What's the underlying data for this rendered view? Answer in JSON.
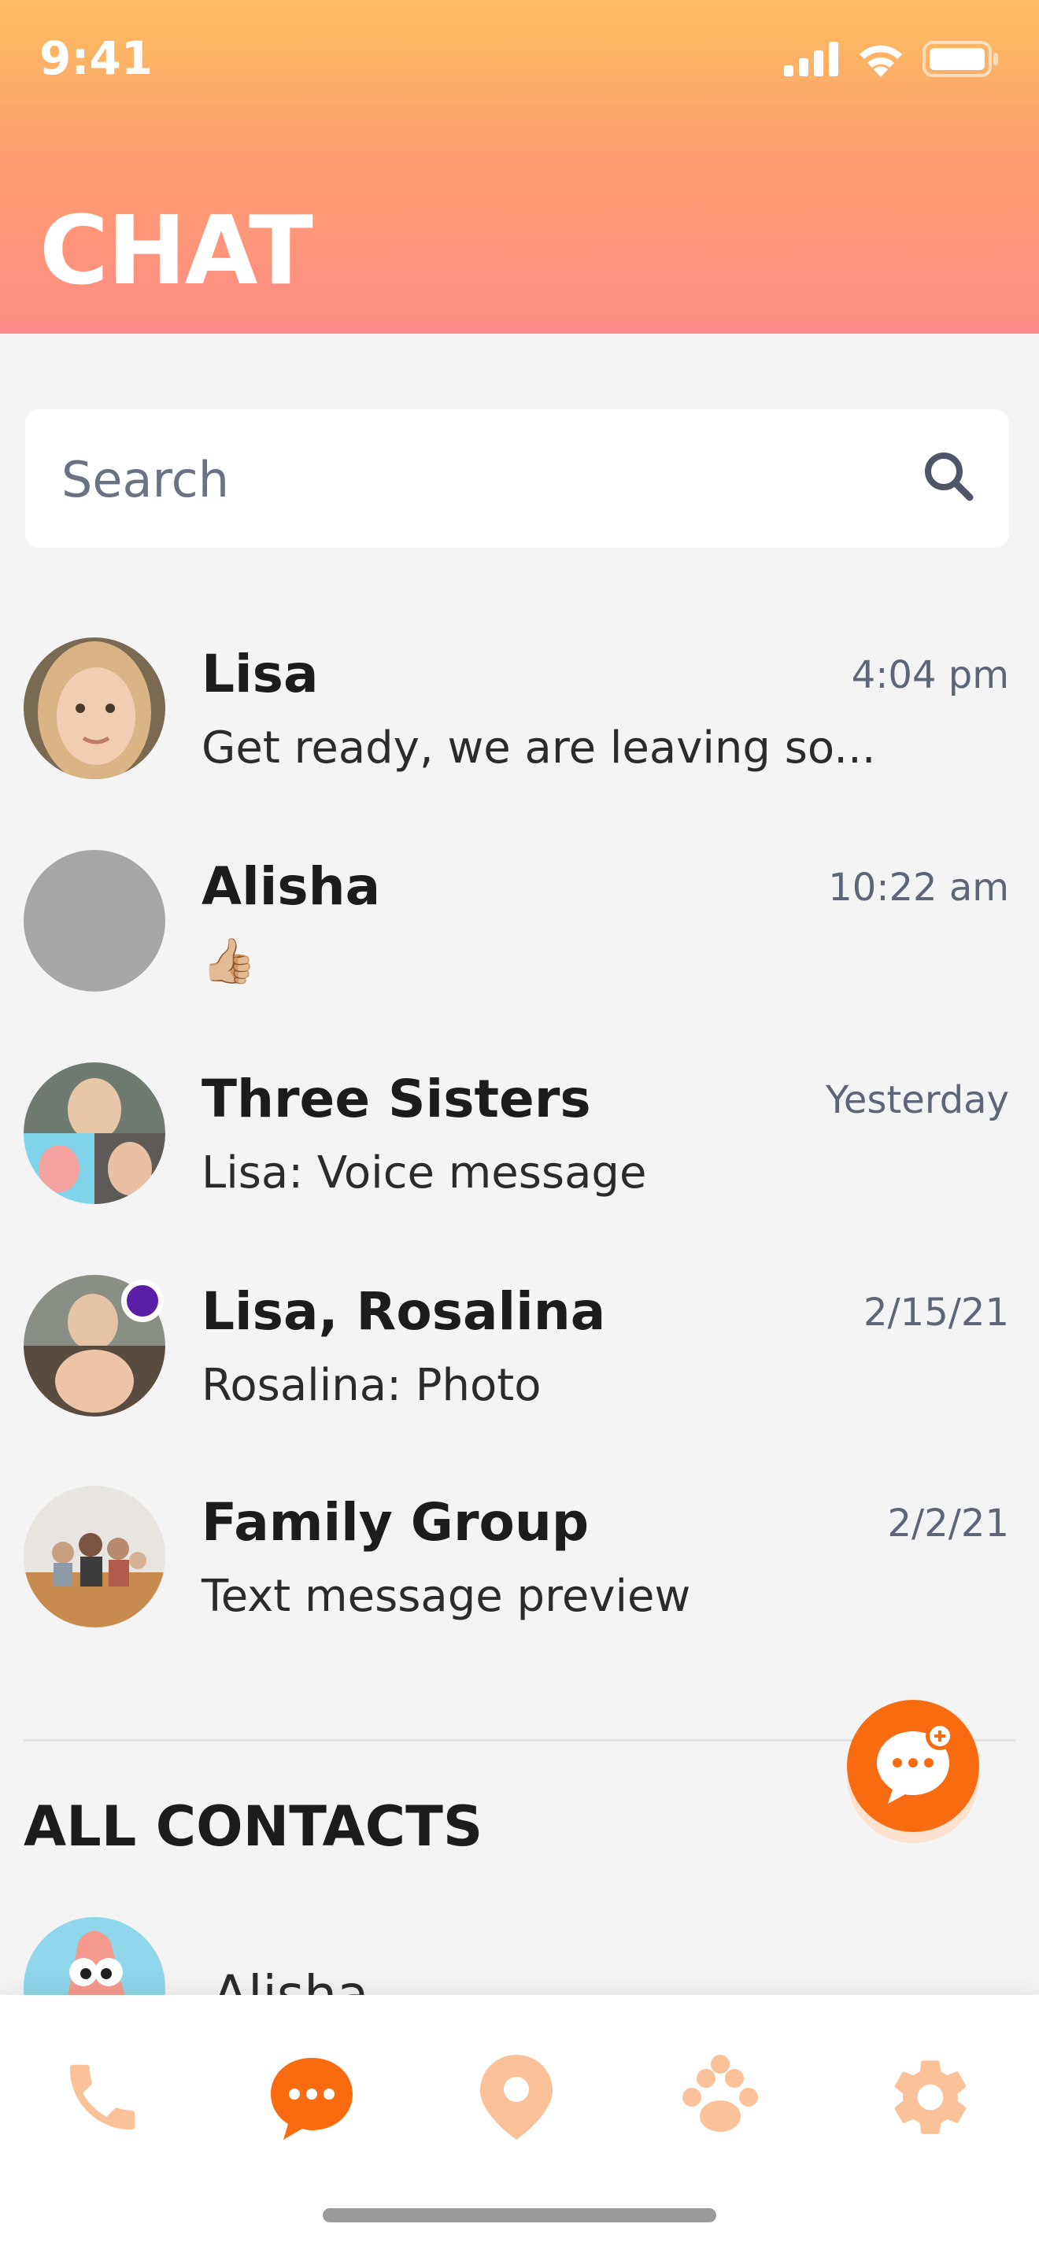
{
  "status_bar": {
    "time": "9:41"
  },
  "header": {
    "title": "CHAT"
  },
  "search": {
    "placeholder": "Search"
  },
  "chats": [
    {
      "name": "Lisa",
      "time": "4:04 pm",
      "preview": "Get ready, we are leaving so..."
    },
    {
      "name": "Alisha",
      "time": "10:22 am",
      "preview": "👍🏼"
    },
    {
      "name": "Three Sisters",
      "time": "Yesterday",
      "preview": "Lisa: Voice message"
    },
    {
      "name": "Lisa, Rosalina",
      "time": "2/15/21",
      "preview": "Rosalina: Photo",
      "online": true
    },
    {
      "name": "Family Group",
      "time": "2/2/21",
      "preview": "Text message preview"
    }
  ],
  "contacts_section": {
    "title": "ALL CONTACTS",
    "items": [
      {
        "name": "Alisha"
      }
    ]
  },
  "tab_bar": {
    "tabs": [
      {
        "icon": "phone-icon",
        "selected": false
      },
      {
        "icon": "chat-icon",
        "selected": true
      },
      {
        "icon": "location-icon",
        "selected": false
      },
      {
        "icon": "paw-icon",
        "selected": false
      },
      {
        "icon": "gear-icon",
        "selected": false
      }
    ]
  },
  "fab": {
    "icon": "new-chat-icon"
  },
  "colors": {
    "accent": "#f96b10",
    "tab_inactive": "#fbc29a",
    "header_gradient_top": "#fdbd61",
    "header_gradient_bottom": "#fe8b86",
    "online_dot": "#5b1fa8"
  }
}
